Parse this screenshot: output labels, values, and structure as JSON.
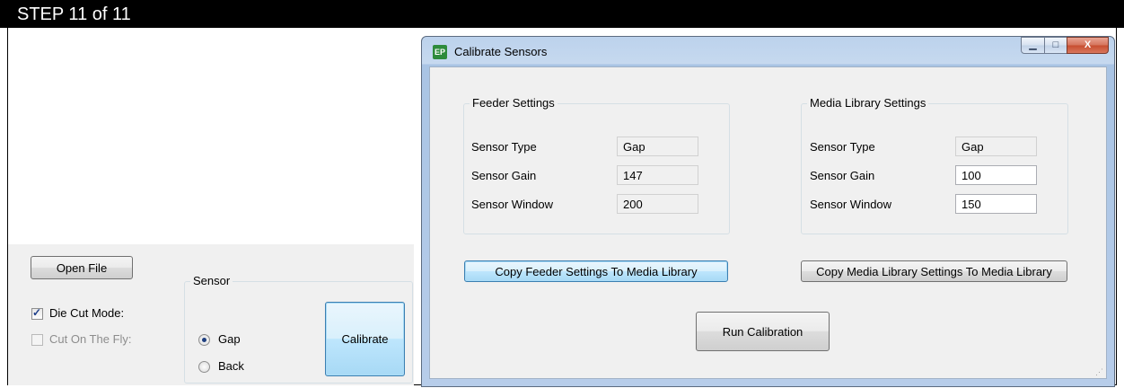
{
  "step_banner": "STEP 11 of 11",
  "background_app": {
    "open_file_label": "Open File",
    "die_cut_mode_label": "Die Cut Mode:",
    "die_cut_mode_checked": true,
    "cut_on_the_fly_label": "Cut On The Fly:",
    "cut_on_the_fly_checked": false,
    "sensor_group_title": "Sensor",
    "sensor_options": [
      {
        "label": "Gap",
        "selected": true
      },
      {
        "label": "Back",
        "selected": false
      }
    ],
    "calibrate_label": "Calibrate"
  },
  "dialog": {
    "title": "Calibrate Sensors",
    "app_icon_text": "EP",
    "window_buttons": {
      "minimize": "▁",
      "maximize": "□",
      "close": "X"
    },
    "feeder": {
      "title": "Feeder Settings",
      "rows": [
        {
          "label": "Sensor Type",
          "value": "Gap"
        },
        {
          "label": "Sensor Gain",
          "value": "147"
        },
        {
          "label": "Sensor Window",
          "value": "200"
        }
      ]
    },
    "media": {
      "title": "Media Library Settings",
      "rows": [
        {
          "label": "Sensor Type",
          "value": "Gap"
        },
        {
          "label": "Sensor Gain",
          "value": "100"
        },
        {
          "label": "Sensor Window",
          "value": "150"
        }
      ]
    },
    "copy_feeder_label": "Copy Feeder Settings To Media Library",
    "copy_media_label": "Copy Media Library Settings To Media Library",
    "run_calibration_label": "Run Calibration"
  },
  "colors": {
    "step_bar": "#000000",
    "dialog_frame": "#b9cfe9",
    "close_button": "#c74d2f"
  }
}
